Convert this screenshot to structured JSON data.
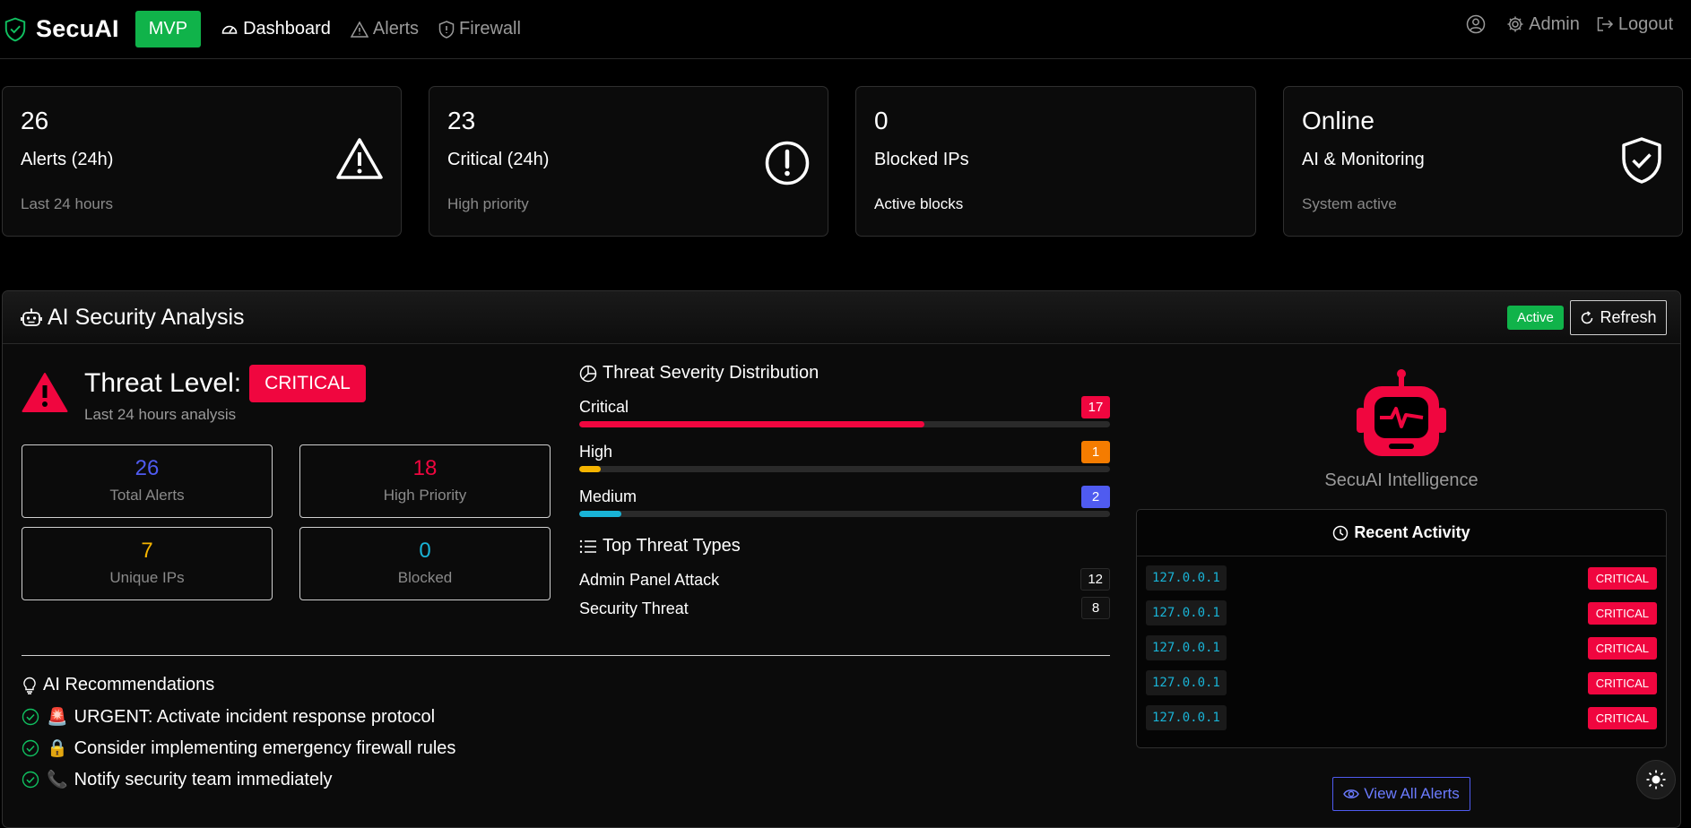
{
  "nav": {
    "brand": "SecuAI",
    "badge": "MVP",
    "links": [
      {
        "label": "Dashboard",
        "icon": "dashboard-icon",
        "active": true
      },
      {
        "label": "Alerts",
        "icon": "alert-icon"
      },
      {
        "label": "Firewall",
        "icon": "shield-icon"
      }
    ],
    "user_icon": "user-circle-icon",
    "admin": "Admin",
    "logout": "Logout"
  },
  "stats": [
    {
      "value": "26",
      "label": "Alerts (24h)",
      "sub": "Last 24 hours",
      "icon": "warning-triangle-icon"
    },
    {
      "value": "23",
      "label": "Critical (24h)",
      "sub": "High priority",
      "icon": "exclamation-circle-icon"
    },
    {
      "value": "0",
      "label": "Blocked IPs",
      "sub": "Active blocks"
    },
    {
      "value": "Online",
      "label": "AI & Monitoring",
      "sub": "System active",
      "icon": "shield-check-icon"
    }
  ],
  "analysis": {
    "title": "AI Security Analysis",
    "status": "Active",
    "refresh": "Refresh",
    "threat_label": "Threat Level:",
    "threat_level": "CRITICAL",
    "threat_sub": "Last 24 hours analysis",
    "metrics": [
      {
        "value": "26",
        "label": "Total Alerts",
        "color": "#4f5bf0"
      },
      {
        "value": "18",
        "label": "High Priority",
        "color": "#f0063f"
      },
      {
        "value": "7",
        "label": "Unique IPs",
        "color": "#f5b400"
      },
      {
        "value": "0",
        "label": "Blocked",
        "color": "#19b3d6"
      }
    ],
    "severity_title": "Threat Severity Distribution",
    "severity": [
      {
        "name": "Critical",
        "count": "17",
        "color": "#f0063f",
        "fraction": 0.65
      },
      {
        "name": "High",
        "count": "1",
        "color": "#f5b400",
        "badge": "#f57c00",
        "fraction": 0.04
      },
      {
        "name": "Medium",
        "count": "2",
        "color": "#19b3d6",
        "badge": "#4f5bf0",
        "fraction": 0.08
      }
    ],
    "types_title": "Top Threat Types",
    "types": [
      {
        "name": "Admin Panel Attack",
        "count": "12"
      },
      {
        "name": "Security Threat",
        "count": "8"
      }
    ],
    "recommendations_title": "AI Recommendations",
    "recommendations": [
      {
        "emoji": "🚨",
        "text": "URGENT: Activate incident response protocol"
      },
      {
        "emoji": "🔒",
        "text": "Consider implementing emergency firewall rules"
      },
      {
        "emoji": "📞",
        "text": "Notify security team immediately"
      }
    ],
    "intel_title": "SecuAI Intelligence",
    "activity_title": "Recent Activity",
    "activity": [
      {
        "ip": "127.0.0.1",
        "severity": "CRITICAL"
      },
      {
        "ip": "127.0.0.1",
        "severity": "CRITICAL"
      },
      {
        "ip": "127.0.0.1",
        "severity": "CRITICAL"
      },
      {
        "ip": "127.0.0.1",
        "severity": "CRITICAL"
      },
      {
        "ip": "127.0.0.1",
        "severity": "CRITICAL"
      }
    ],
    "view_all": "View All Alerts"
  }
}
